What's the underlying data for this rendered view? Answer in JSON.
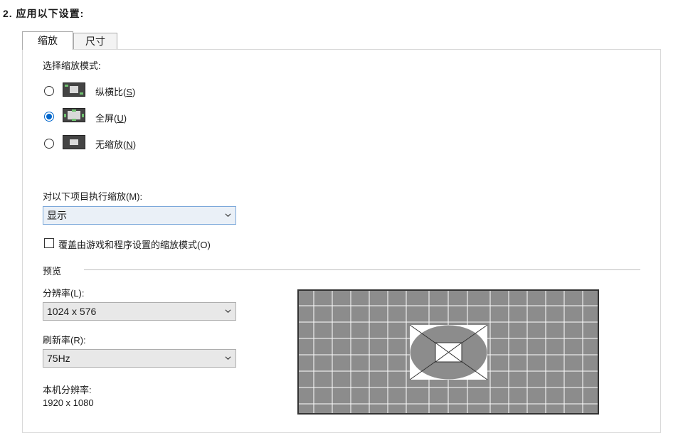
{
  "step": {
    "title": "2. 应用以下设置:"
  },
  "tabs": [
    {
      "label": "缩放",
      "active": true
    },
    {
      "label": "尺寸",
      "active": false
    }
  ],
  "scale_mode": {
    "heading": "选择缩放模式:",
    "options": [
      {
        "label_text": "纵横比(",
        "hotkey": "S",
        "label_end": ")",
        "icon": "aspect-ratio-icon",
        "checked": false
      },
      {
        "label_text": "全屏(",
        "hotkey": "U",
        "label_end": ")",
        "icon": "full-screen-icon",
        "checked": true
      },
      {
        "label_text": "无缩放(",
        "hotkey": "N",
        "label_end": ")",
        "icon": "no-scaling-icon",
        "checked": false
      }
    ]
  },
  "perform_on": {
    "label": "对以下项目执行缩放(M):",
    "selected": "显示"
  },
  "override": {
    "label": "覆盖由游戏和程序设置的缩放模式(O)",
    "checked": false
  },
  "preview": {
    "section_label": "预览",
    "resolution_label": "分辨率(L):",
    "resolution_value": "1024 x 576",
    "refresh_label": "刷新率(R):",
    "refresh_value": "75Hz",
    "native_label": "本机分辨率:",
    "native_value": "1920 x 1080"
  },
  "colors": {
    "accent": "#0066cc",
    "preview_bg": "#8c8c8c",
    "grid_line": "#ffffff"
  }
}
